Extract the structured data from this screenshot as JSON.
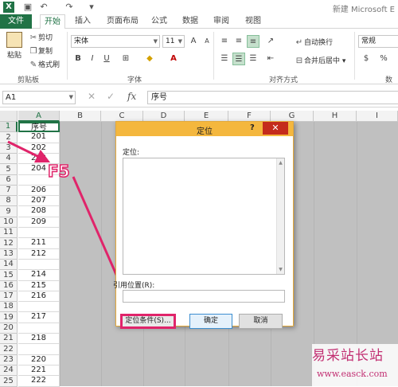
{
  "window": {
    "title": "新建 Microsoft E",
    "app_icon": "X"
  },
  "qat": {
    "save_icon": "save-icon",
    "undo_icon": "undo-icon",
    "redo_icon": "redo-icon"
  },
  "tabs": [
    {
      "label": "文件"
    },
    {
      "label": "开始"
    },
    {
      "label": "插入"
    },
    {
      "label": "页面布局"
    },
    {
      "label": "公式"
    },
    {
      "label": "数据"
    },
    {
      "label": "审阅"
    },
    {
      "label": "视图"
    }
  ],
  "ribbon": {
    "clipboard": {
      "paste": "粘贴",
      "cut": "剪切",
      "copy": "复制",
      "format_painter": "格式刷",
      "group": "剪贴板"
    },
    "font": {
      "name": "宋体",
      "size": "11",
      "bold": "B",
      "italic": "I",
      "underline": "U",
      "group": "字体"
    },
    "alignment": {
      "wrap": "自动换行",
      "merge": "合并后居中",
      "group": "对齐方式"
    },
    "number": {
      "format": "常规",
      "group": "数字"
    }
  },
  "formula_bar": {
    "name_box": "A1",
    "fx": "fx",
    "content": "序号"
  },
  "columns": [
    "A",
    "B",
    "C",
    "D",
    "E",
    "F",
    "G",
    "H",
    "I"
  ],
  "rows": [
    "1",
    "2",
    "3",
    "4",
    "5",
    "6",
    "7",
    "8",
    "9",
    "10",
    "11",
    "12",
    "13",
    "14",
    "15",
    "16",
    "17",
    "18",
    "19",
    "20",
    "21",
    "22",
    "23",
    "24",
    "25"
  ],
  "cells_a": [
    "序号",
    "201",
    "202",
    "203",
    "204",
    "",
    "206",
    "207",
    "208",
    "209",
    "",
    "211",
    "212",
    "",
    "214",
    "215",
    "216",
    "",
    "217",
    "",
    "218",
    "",
    "220",
    "221",
    "222"
  ],
  "dialog": {
    "title": "定位",
    "help": "?",
    "close": "✕",
    "goto_label": "定位:",
    "ref_label": "引用位置(R):",
    "special_button": "定位条件(S)...",
    "ok_button": "确定",
    "cancel_button": "取消"
  },
  "annotation": {
    "key": "F5",
    "color": "#e0246a"
  },
  "watermark": {
    "cn": "易采站长站",
    "en": "www.easck.com"
  }
}
